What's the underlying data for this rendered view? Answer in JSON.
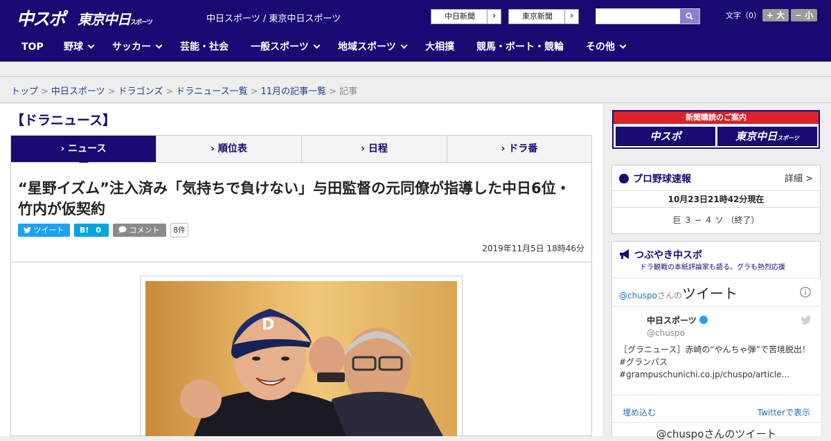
{
  "header": {
    "logo_chuspo": "中スポ",
    "logo_tokyo": "東京中日",
    "logo_tokyo_sub": "スポーツ",
    "site_title": "中日スポーツ / 東京中日スポーツ",
    "link_chunichi": "中日新聞",
    "link_tokyo": "東京新聞",
    "link_arrow": "›",
    "search_placeholder": "",
    "font_size_label": "文字（0）",
    "font_larger": "+ 大",
    "font_smaller": "− 小"
  },
  "nav": {
    "items": [
      {
        "label": "TOP"
      },
      {
        "label": "野球"
      },
      {
        "label": "サッカー"
      },
      {
        "label": "芸能・社会"
      },
      {
        "label": "一般スポーツ"
      },
      {
        "label": "地域スポーツ"
      },
      {
        "label": "大相撲"
      },
      {
        "label": "競馬・ボート・競輪"
      },
      {
        "label": "その他"
      }
    ]
  },
  "breadcrumb": {
    "items": [
      "トップ",
      "中日スポーツ",
      "ドラゴンズ",
      "ドラニュース一覧",
      "11月の記事一覧"
    ],
    "separator": ">",
    "current": "記事"
  },
  "section": {
    "title": "【ドラニュース】"
  },
  "tabs": [
    {
      "label": "› ニュース"
    },
    {
      "label": "› 順位表"
    },
    {
      "label": "› 日程"
    },
    {
      "label": "› ドラ番"
    }
  ],
  "article": {
    "headline": "“星野イズム”注入済み「気持ちで負けない」与田監督の元同僚が指導した中日6位・竹内が仮契約",
    "tweet_label": "ツイート",
    "hatena_label": "B!",
    "hatena_count": "0",
    "comment_label": "コメント",
    "comment_count": "8件",
    "date": "2019年11月5日 18時46分"
  },
  "sidebar": {
    "ad_top": "新聞購読のご案内",
    "ad_btn1": "中スポ",
    "ad_btn2": "東京中日",
    "ad_btn2_sub": "スポーツ",
    "baseball": {
      "title": "プロ野球速報",
      "detail": "詳細 >",
      "timestamp": "10月23日21時42分現在",
      "score": "巨 ３ − ４ ソ （終了）"
    },
    "tsubuyaki": {
      "title": "つぶやき中スポ",
      "subtitle": "ドラ観戦の本紙評論家も語る。グラも熱烈応援"
    },
    "twitter": {
      "handle_prefix": "@chuspo",
      "handle_suffix": "さんの",
      "tweets_word": "ツイート",
      "account_name": "中日スポーツ",
      "account_handle": "@chuspo",
      "tweet_text": "［グラニュース］赤崎の“やんちゃ弾”で苦境脱出！#グランパス #grampuschunichi.co.jp/chuspo/article…",
      "embed": "埋め込む",
      "view_on_twitter": "Twitterで表示",
      "footer_text": "@chuspoさんのツイート"
    }
  },
  "colors": {
    "brand_navy": "#170a72",
    "link_blue": "#1f3f8f",
    "twitter_blue": "#1da1f2",
    "hatena_blue": "#00a4de",
    "ad_red": "#d8242a"
  }
}
